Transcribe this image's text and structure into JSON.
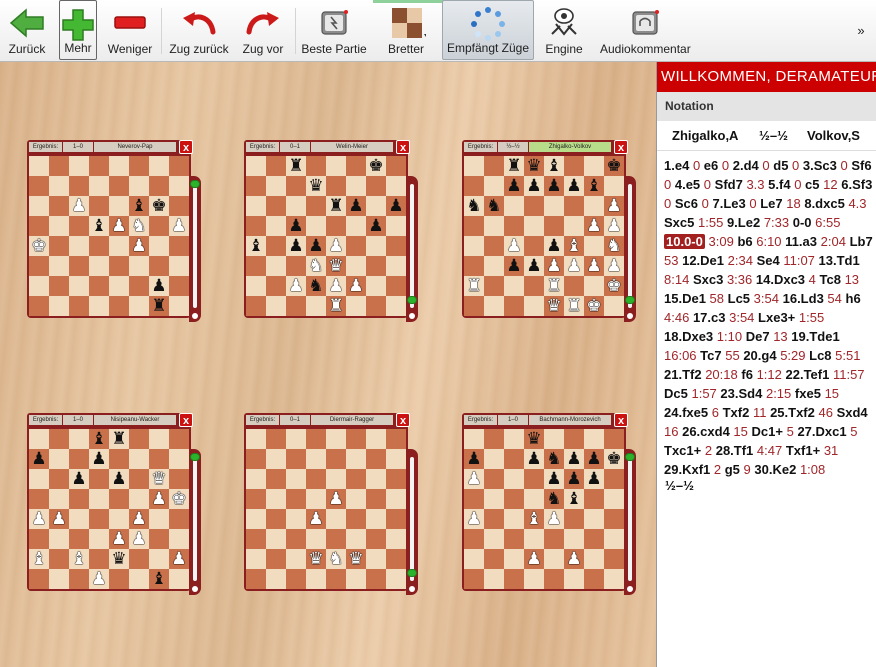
{
  "toolbar": {
    "back": "Zurück",
    "more": "Mehr",
    "less": "Weniger",
    "undo": "Zug zurück",
    "redo": "Zug vor",
    "best": "Beste Partie",
    "boards": "Bretter",
    "receive": "Empfängt Züge",
    "engine": "Engine",
    "audio": "Audiokommentar",
    "overflow": "»"
  },
  "games": [
    {
      "label": "Ergebnis:",
      "result": "1–0",
      "names": "Neverov-Pap",
      "highlight": false,
      "slider": 0.0,
      "rows": [
        "........",
        "........",
        "..P..bk.",
        "...bPN.P",
        "K....P..",
        "........",
        "......p.",
        "......r."
      ]
    },
    {
      "label": "Ergebnis:",
      "result": "0–1",
      "names": "Welin-Meier",
      "highlight": false,
      "slider": 1.0,
      "rows": [
        "..r...k.",
        "...q....",
        "....rp.p",
        "..p...p.",
        "b.ppP...",
        "...NQ...",
        "..PnPP..",
        "....R..."
      ]
    },
    {
      "label": "Ergebnis:",
      "result": "½–½",
      "names": "Zhigalko-Volkov",
      "highlight": true,
      "slider": 1.0,
      "rows": [
        "..rqb..k",
        "..ppppb.",
        "nn.....P",
        "......PP",
        "..P.pB.N",
        "..ppPPPP",
        "R...R..K",
        "....QRK."
      ]
    },
    {
      "label": "Ergebnis:",
      "result": "1–0",
      "names": "Nisipeanu-Wacker",
      "highlight": false,
      "slider": 0.0,
      "rows": [
        "...br...",
        "p..p....",
        "..p.p.Q.",
        "......PK",
        "PP...P..",
        "....PP..",
        "B.B.q..P",
        "...P..b."
      ]
    },
    {
      "label": "Ergebnis:",
      "result": "0–1",
      "names": "Diermair-Ragger",
      "highlight": false,
      "slider": 1.0,
      "rows": [
        "........",
        "........",
        "........",
        "....P...",
        "...P....",
        "........",
        "...QNQ..",
        "........"
      ]
    },
    {
      "label": "Ergebnis:",
      "result": "1–0",
      "names": "Bachmann-Morozevich",
      "highlight": false,
      "slider": 0.0,
      "rows": [
        "...q....",
        "p..pnppk",
        "P...ppp.",
        "....nb..",
        "P..BP...",
        "........",
        "...P.P..",
        "........"
      ]
    }
  ],
  "sidebar": {
    "welcome": "WILLKOMMEN, DERAMATEUR",
    "notation_header": "Notation",
    "white": "Zhigalko,A",
    "result": "½–½",
    "black": "Volkov,S",
    "moves": [
      [
        "1.e4",
        "0"
      ],
      [
        "e6",
        "0"
      ],
      [
        "2.d4",
        "0"
      ],
      [
        "d5",
        "0"
      ],
      [
        "3.Sc3",
        "0"
      ],
      [
        "Sf6",
        "0"
      ],
      [
        "4.e5",
        "0"
      ],
      [
        "Sfd7",
        "3.3"
      ],
      [
        "5.f4",
        "0"
      ],
      [
        "c5",
        "12"
      ],
      [
        "6.Sf3",
        "0"
      ],
      [
        "Sc6",
        "0"
      ],
      [
        "7.Le3",
        "0"
      ],
      [
        "Le7",
        "18"
      ],
      [
        "8.dxc5",
        "4.3"
      ],
      [
        "Sxc5",
        "1:55"
      ],
      [
        "9.Le2",
        "7:33"
      ],
      [
        "0-0",
        "6:55"
      ],
      [
        "10.0-0",
        "3:09"
      ],
      [
        "b6",
        "6:10"
      ],
      [
        "11.a3",
        "2:04"
      ],
      [
        "Lb7",
        "53"
      ],
      [
        "12.De1",
        "2:34"
      ],
      [
        "Se4",
        "11:07"
      ],
      [
        "13.Td1",
        "8:14"
      ],
      [
        "Sxc3",
        "3:36"
      ],
      [
        "14.Dxc3",
        "4"
      ],
      [
        "Tc8",
        "13"
      ],
      [
        "15.De1",
        "58"
      ],
      [
        "Lc5",
        "3:54"
      ],
      [
        "16.Ld3",
        "54"
      ],
      [
        "h6",
        "4:46"
      ],
      [
        "17.c3",
        "3:54"
      ],
      [
        "Lxe3+",
        "1:55"
      ],
      [
        "18.Dxe3",
        "1:10"
      ],
      [
        "De7",
        "13"
      ],
      [
        "19.Tde1",
        "16:06"
      ],
      [
        "Tc7",
        "55"
      ],
      [
        "20.g4",
        "5:29"
      ],
      [
        "Lc8",
        "5:51"
      ],
      [
        "21.Tf2",
        "20:18"
      ],
      [
        "f6",
        "1:12"
      ],
      [
        "22.Tef1",
        "11:57"
      ],
      [
        "Dc5",
        "1:57"
      ],
      [
        "23.Sd4",
        "2:15"
      ],
      [
        "fxe5",
        "15"
      ],
      [
        "24.fxe5",
        "6"
      ],
      [
        "Txf2",
        "11"
      ],
      [
        "25.Txf2",
        "46"
      ],
      [
        "Sxd4",
        "16"
      ],
      [
        "26.cxd4",
        "15"
      ],
      [
        "Dc1+",
        "5"
      ],
      [
        "27.Dxc1",
        "5"
      ],
      [
        "Txc1+",
        "2"
      ],
      [
        "28.Tf1",
        "4:47"
      ],
      [
        "Txf1+",
        "31"
      ],
      [
        "29.Kxf1",
        "2"
      ],
      [
        "g5",
        "9"
      ],
      [
        "30.Ke2",
        "1:08"
      ]
    ],
    "current_move": "10.0-0",
    "final": "½–½"
  },
  "colors": {
    "accent": "#cc0000",
    "frame": "#8b1e1e",
    "light": "#f2dcc0",
    "dark": "#c8714a"
  }
}
